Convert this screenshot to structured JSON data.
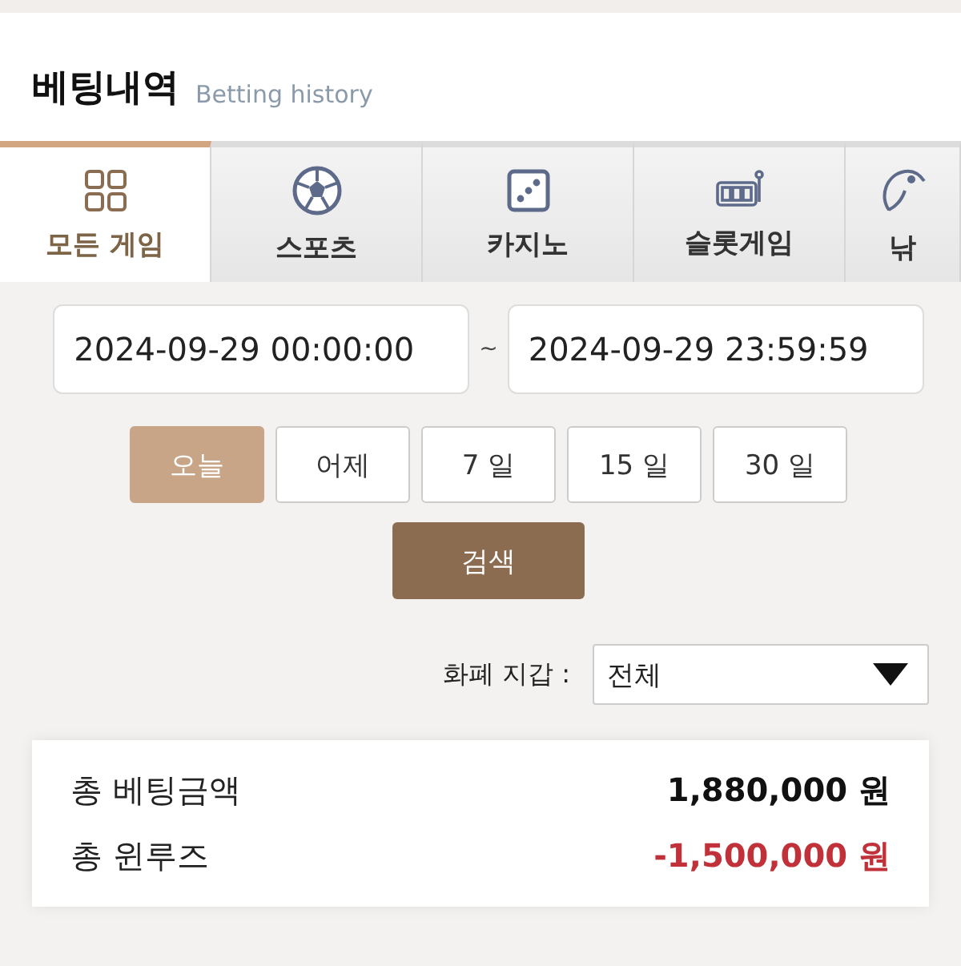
{
  "header": {
    "title": "베팅내역",
    "subtitle": "Betting history"
  },
  "tabs": [
    {
      "label": "모든 게임",
      "kind": "all",
      "selected": true
    },
    {
      "label": "스포츠",
      "kind": "sports",
      "selected": false
    },
    {
      "label": "카지노",
      "kind": "casino",
      "selected": false
    },
    {
      "label": "슬롯게임",
      "kind": "slot",
      "selected": false
    },
    {
      "label": "낚",
      "kind": "fishing",
      "selected": false
    }
  ],
  "date_range": {
    "from": "2024-09-29 00:00:00",
    "separator": "~",
    "to": "2024-09-29 23:59:59"
  },
  "periods": [
    {
      "label": "오늘",
      "selected": true
    },
    {
      "label": "어제",
      "selected": false
    },
    {
      "label": "7 일",
      "selected": false
    },
    {
      "label": "15 일",
      "selected": false
    },
    {
      "label": "30 일",
      "selected": false
    }
  ],
  "search_button": "검색",
  "wallet": {
    "label": "화폐 지갑 :",
    "value": "전체"
  },
  "summary": [
    {
      "label": "총 베팅금액",
      "value": "1,880,000 원",
      "color": "#111111"
    },
    {
      "label": "총 윈루즈",
      "value": "-1,500,000 원",
      "color": "#c0313a"
    }
  ]
}
